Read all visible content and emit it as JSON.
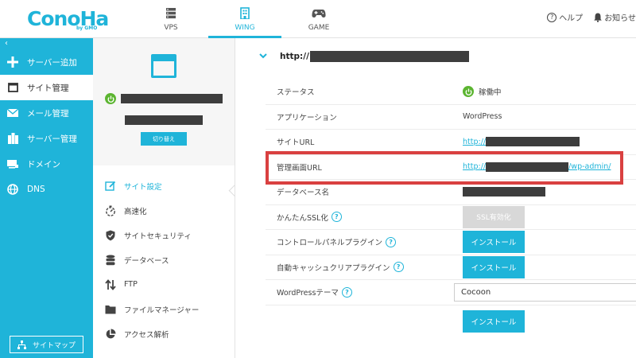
{
  "header": {
    "logo_text": "ConoHa",
    "logo_sub": "by GMO",
    "nav": [
      {
        "label": "VPS",
        "icon": "server-stack-icon"
      },
      {
        "label": "WING",
        "icon": "building-icon"
      },
      {
        "label": "GAME",
        "icon": "gamepad-icon"
      }
    ],
    "help_label": "ヘルプ",
    "notice_label": "お知らせ"
  },
  "sidebar": {
    "back_label": "‹",
    "items": [
      {
        "label": "サーバー追加",
        "icon": "plus-icon"
      },
      {
        "label": "サイト管理",
        "icon": "window-icon"
      },
      {
        "label": "メール管理",
        "icon": "mail-icon"
      },
      {
        "label": "サーバー管理",
        "icon": "server-icon"
      },
      {
        "label": "ドメイン",
        "icon": "domain-icon"
      },
      {
        "label": "DNS",
        "icon": "globe-icon"
      }
    ],
    "sitemap_label": "サイトマップ"
  },
  "server_card": {
    "switch_label": "切り替え"
  },
  "submenu": {
    "items": [
      {
        "label": "サイト設定",
        "icon": "edit-icon"
      },
      {
        "label": "高速化",
        "icon": "stopwatch-icon"
      },
      {
        "label": "サイトセキュリティ",
        "icon": "shield-icon"
      },
      {
        "label": "データベース",
        "icon": "database-icon"
      },
      {
        "label": "FTP",
        "icon": "transfer-icon"
      },
      {
        "label": "ファイルマネージャー",
        "icon": "folder-icon"
      },
      {
        "label": "アクセス解析",
        "icon": "pie-chart-icon"
      }
    ]
  },
  "main": {
    "title_prefix": "http://",
    "rows": {
      "status": {
        "label": "ステータス",
        "value": "稼働中"
      },
      "application": {
        "label": "アプリケーション",
        "value": "WordPress"
      },
      "site_url": {
        "label": "サイトURL",
        "prefix": "http://"
      },
      "admin_url": {
        "label": "管理画面URL",
        "prefix": "http://",
        "suffix": "/wp-admin/"
      },
      "database": {
        "label": "データベース名"
      },
      "ssl": {
        "label": "かんたんSSL化",
        "button": "SSL有効化"
      },
      "cp_plugin": {
        "label": "コントロールパネルプラグイン",
        "button": "インストール"
      },
      "cache_plugin": {
        "label": "自動キャッシュクリアプラグイン",
        "button": "インストール"
      },
      "theme": {
        "label": "WordPressテーマ",
        "value": "Cocoon"
      },
      "theme_install": {
        "button": "インストール"
      }
    }
  },
  "colors": {
    "accent": "#1fb4d9",
    "status_green": "#5cb531",
    "highlight": "#d94040"
  }
}
